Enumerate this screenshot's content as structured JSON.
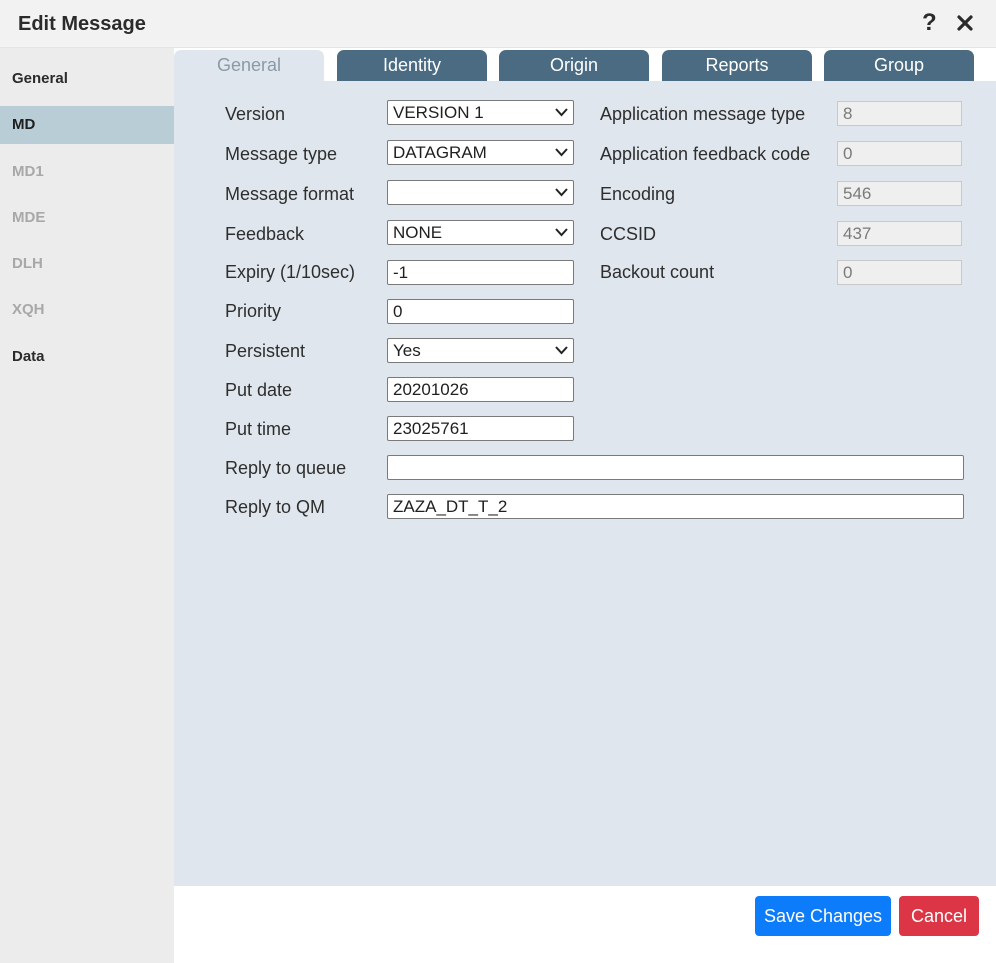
{
  "dialog": {
    "title": "Edit Message"
  },
  "sidebar": {
    "items": [
      {
        "label": "General",
        "state": "enabled"
      },
      {
        "label": "MD",
        "state": "active"
      },
      {
        "label": "MD1",
        "state": "disabled"
      },
      {
        "label": "MDE",
        "state": "disabled"
      },
      {
        "label": "DLH",
        "state": "disabled"
      },
      {
        "label": "XQH",
        "state": "disabled"
      },
      {
        "label": "Data",
        "state": "enabled"
      }
    ]
  },
  "tabs": [
    {
      "label": "General",
      "active": true
    },
    {
      "label": "Identity",
      "active": false
    },
    {
      "label": "Origin",
      "active": false
    },
    {
      "label": "Reports",
      "active": false
    },
    {
      "label": "Group",
      "active": false
    }
  ],
  "form": {
    "version": {
      "label": "Version",
      "value": "VERSION 1"
    },
    "message_type": {
      "label": "Message type",
      "value": "DATAGRAM"
    },
    "message_format": {
      "label": "Message format",
      "value": ""
    },
    "feedback": {
      "label": "Feedback",
      "value": "NONE"
    },
    "expiry": {
      "label": "Expiry (1/10sec)",
      "value": "-1"
    },
    "priority": {
      "label": "Priority",
      "value": "0"
    },
    "persistent": {
      "label": "Persistent",
      "value": "Yes"
    },
    "put_date": {
      "label": "Put date",
      "value": "20201026"
    },
    "put_time": {
      "label": "Put time",
      "value": "23025761"
    },
    "reply_to_queue": {
      "label": "Reply to queue",
      "value": ""
    },
    "reply_to_qm": {
      "label": "Reply to QM",
      "value": "ZAZA_DT_T_2"
    },
    "app_message_type": {
      "label": "Application message type",
      "value": "8"
    },
    "app_feedback_code": {
      "label": "Application feedback code",
      "value": "0"
    },
    "encoding": {
      "label": "Encoding",
      "value": "546"
    },
    "ccsid": {
      "label": "CCSID",
      "value": "437"
    },
    "backout_count": {
      "label": "Backout count",
      "value": "0"
    }
  },
  "footer": {
    "save_label": "Save Changes",
    "cancel_label": "Cancel"
  },
  "colors": {
    "tab": "#4b6b82",
    "active_side": "#b9cdd6",
    "content_bg": "#dfe6ed",
    "save": "#0d7cfb",
    "cancel": "#dc3545"
  }
}
